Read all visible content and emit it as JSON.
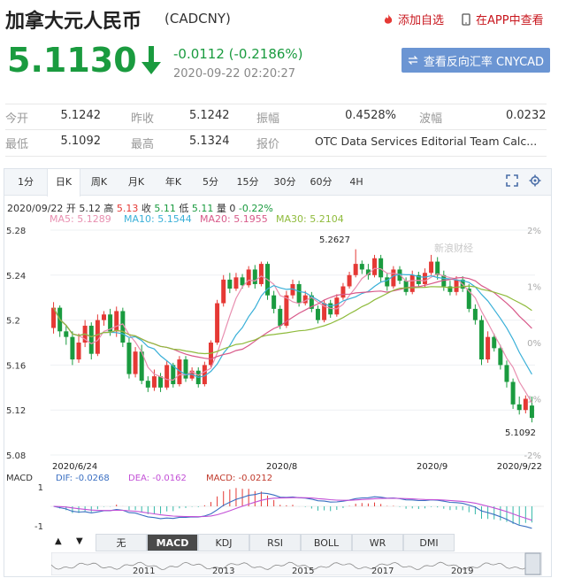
{
  "header": {
    "title": "加拿大元人民币",
    "code": "(CADCNY)",
    "add_fav": "添加自选",
    "app_view": "在APP中查看"
  },
  "quote": {
    "price": "5.1130",
    "change": "-0.0112 (-0.2186%)",
    "timestamp": "2020-09-22 02:20:27",
    "reverse_button": "查看反向汇率 CNYCAD"
  },
  "stats": [
    [
      {
        "label": "今开",
        "value": "5.1242"
      },
      {
        "label": "昨收",
        "value": "5.1242"
      },
      {
        "label": "振幅",
        "value": "0.4528%"
      },
      {
        "label": "波幅",
        "value": "0.0232"
      }
    ],
    [
      {
        "label": "最低",
        "value": "5.1092"
      },
      {
        "label": "最高",
        "value": "5.1324"
      },
      {
        "label": "报价",
        "value": "OTC Data Services Editorial Team Calc..."
      }
    ]
  ],
  "tabs": [
    "1分",
    "日K",
    "周K",
    "月K",
    "年K",
    "5分",
    "15分",
    "30分",
    "60分",
    "4H"
  ],
  "active_tab": "日K",
  "kline_info": {
    "date": "2020/09/22",
    "open_label": "开",
    "open": "5.12",
    "high_label": "高",
    "high": "5.13",
    "close_label": "收",
    "close": "5.11",
    "low_label": "低",
    "low": "5.11",
    "vol_label": "量",
    "vol": "0",
    "pct": "-0.22%"
  },
  "ma_legend": [
    {
      "label": "MA5: 5.1289",
      "color": "#e88fb0"
    },
    {
      "label": "MA10: 5.1544",
      "color": "#3ab0d8"
    },
    {
      "label": "MA20: 5.1955",
      "color": "#d85a8a"
    },
    {
      "label": "MA30: 5.2104",
      "color": "#8fbb3c"
    }
  ],
  "macd_legend": {
    "title": "MACD",
    "dif": "DIF: -0.0268",
    "dea": "DEA: -0.0162",
    "macd": "MACD: -0.0212"
  },
  "indicator_tabs": [
    "无",
    "MACD",
    "KDJ",
    "RSI",
    "BOLL",
    "WR",
    "DMI"
  ],
  "active_indicator": "MACD",
  "watermark": "新浪财经",
  "colors": {
    "up": "#e53935",
    "down": "#1a9b3f",
    "accent": "#6b95d3",
    "brand_red": "#c8161d"
  },
  "chart_data": {
    "type": "candlestick",
    "ylim": [
      5.08,
      5.28
    ],
    "y_ticks": [
      "5.28",
      "5.24",
      "5.2",
      "5.16",
      "5.12",
      "5.08"
    ],
    "pct_ticks": [
      "2%",
      "1%",
      "0%",
      "-1%",
      "-2%"
    ],
    "x_ticks": [
      "2020/6/24",
      "2020/8",
      "2020/9",
      "2020/9/22"
    ],
    "max_label": "5.2627",
    "min_label": "5.1092",
    "candles": [
      [
        5.193,
        5.211,
        5.216,
        5.188
      ],
      [
        5.211,
        5.19,
        5.213,
        5.185
      ],
      [
        5.19,
        5.185,
        5.195,
        5.178
      ],
      [
        5.185,
        5.165,
        5.19,
        5.16
      ],
      [
        5.165,
        5.18,
        5.188,
        5.162
      ],
      [
        5.18,
        5.195,
        5.2,
        5.176
      ],
      [
        5.195,
        5.17,
        5.198,
        5.165
      ],
      [
        5.17,
        5.2,
        5.205,
        5.168
      ],
      [
        5.2,
        5.205,
        5.208,
        5.195
      ],
      [
        5.205,
        5.19,
        5.21,
        5.186
      ],
      [
        5.19,
        5.208,
        5.212,
        5.185
      ],
      [
        5.208,
        5.18,
        5.211,
        5.176
      ],
      [
        5.18,
        5.152,
        5.184,
        5.148
      ],
      [
        5.152,
        5.172,
        5.176,
        5.149
      ],
      [
        5.172,
        5.146,
        5.178,
        5.143
      ],
      [
        5.146,
        5.14,
        5.15,
        5.136
      ],
      [
        5.14,
        5.15,
        5.156,
        5.137
      ],
      [
        5.15,
        5.14,
        5.153,
        5.136
      ],
      [
        5.14,
        5.16,
        5.164,
        5.138
      ],
      [
        5.16,
        5.143,
        5.162,
        5.14
      ],
      [
        5.143,
        5.165,
        5.168,
        5.141
      ],
      [
        5.165,
        5.148,
        5.168,
        5.145
      ],
      [
        5.148,
        5.155,
        5.158,
        5.146
      ],
      [
        5.155,
        5.143,
        5.158,
        5.14
      ],
      [
        5.143,
        5.16,
        5.163,
        5.141
      ],
      [
        5.16,
        5.18,
        5.182,
        5.158
      ],
      [
        5.18,
        5.215,
        5.218,
        5.178
      ],
      [
        5.215,
        5.236,
        5.24,
        5.212
      ],
      [
        5.236,
        5.228,
        5.242,
        5.224
      ],
      [
        5.228,
        5.238,
        5.242,
        5.226
      ],
      [
        5.238,
        5.231,
        5.241,
        5.228
      ],
      [
        5.231,
        5.245,
        5.248,
        5.229
      ],
      [
        5.245,
        5.232,
        5.249,
        5.228
      ],
      [
        5.232,
        5.25,
        5.252,
        5.23
      ],
      [
        5.25,
        5.222,
        5.252,
        5.218
      ],
      [
        5.222,
        5.21,
        5.226,
        5.206
      ],
      [
        5.21,
        5.195,
        5.213,
        5.192
      ],
      [
        5.195,
        5.222,
        5.226,
        5.193
      ],
      [
        5.222,
        5.232,
        5.236,
        5.219
      ],
      [
        5.232,
        5.215,
        5.235,
        5.212
      ],
      [
        5.215,
        5.222,
        5.226,
        5.213
      ],
      [
        5.222,
        5.21,
        5.225,
        5.207
      ],
      [
        5.21,
        5.2,
        5.213,
        5.197
      ],
      [
        5.2,
        5.215,
        5.218,
        5.198
      ],
      [
        5.215,
        5.205,
        5.218,
        5.202
      ],
      [
        5.205,
        5.22,
        5.223,
        5.203
      ],
      [
        5.22,
        5.23,
        5.233,
        5.218
      ],
      [
        5.23,
        5.24,
        5.243,
        5.228
      ],
      [
        5.24,
        5.25,
        5.263,
        5.238
      ],
      [
        5.25,
        5.245,
        5.253,
        5.241
      ],
      [
        5.245,
        5.24,
        5.25,
        5.236
      ],
      [
        5.24,
        5.255,
        5.258,
        5.238
      ],
      [
        5.255,
        5.238,
        5.258,
        5.234
      ],
      [
        5.238,
        5.23,
        5.242,
        5.226
      ],
      [
        5.23,
        5.245,
        5.248,
        5.228
      ],
      [
        5.245,
        5.235,
        5.248,
        5.232
      ],
      [
        5.235,
        5.225,
        5.238,
        5.222
      ],
      [
        5.225,
        5.24,
        5.244,
        5.223
      ],
      [
        5.24,
        5.232,
        5.243,
        5.229
      ],
      [
        5.232,
        5.242,
        5.246,
        5.229
      ],
      [
        5.242,
        5.252,
        5.258,
        5.24
      ],
      [
        5.252,
        5.24,
        5.256,
        5.236
      ],
      [
        5.24,
        5.23,
        5.244,
        5.226
      ],
      [
        5.23,
        5.225,
        5.235,
        5.222
      ],
      [
        5.225,
        5.236,
        5.239,
        5.222
      ],
      [
        5.236,
        5.228,
        5.239,
        5.225
      ],
      [
        5.228,
        5.21,
        5.232,
        5.207
      ],
      [
        5.21,
        5.2,
        5.214,
        5.196
      ],
      [
        5.2,
        5.165,
        5.204,
        5.16
      ],
      [
        5.165,
        5.185,
        5.19,
        5.162
      ],
      [
        5.185,
        5.175,
        5.188,
        5.172
      ],
      [
        5.175,
        5.16,
        5.178,
        5.156
      ],
      [
        5.16,
        5.145,
        5.164,
        5.14
      ],
      [
        5.145,
        5.125,
        5.148,
        5.121
      ],
      [
        5.125,
        5.12,
        5.132,
        5.116
      ],
      [
        5.12,
        5.13,
        5.133,
        5.117
      ],
      [
        5.124,
        5.113,
        5.132,
        5.109
      ]
    ]
  }
}
